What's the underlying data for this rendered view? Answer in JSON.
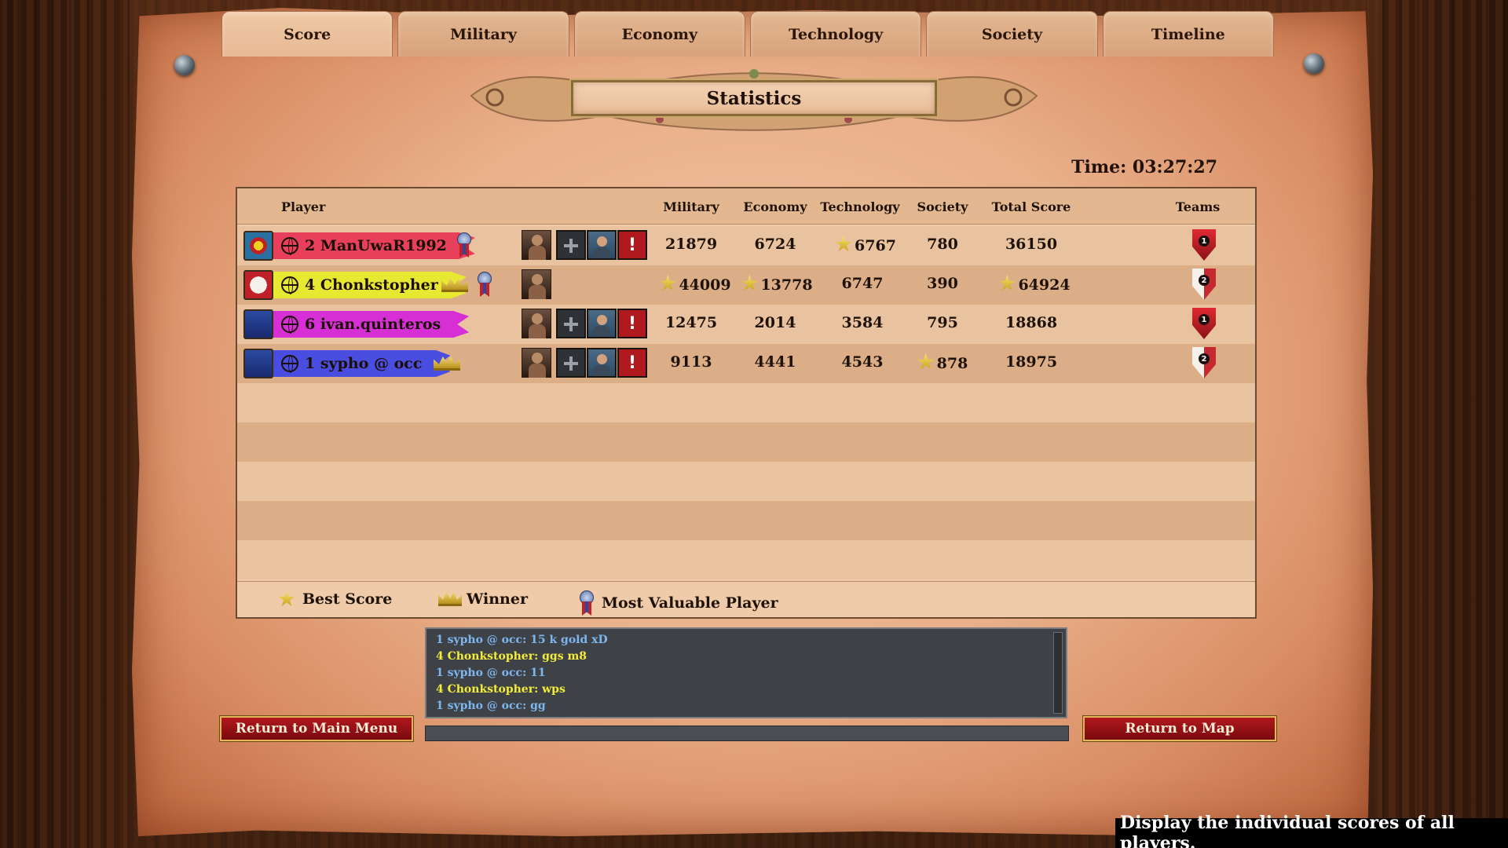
{
  "tabs": [
    "Score",
    "Military",
    "Economy",
    "Technology",
    "Society",
    "Timeline"
  ],
  "title": "Statistics",
  "time": "Time: 03:27:27",
  "columns": {
    "player": "Player",
    "military": "Military",
    "economy": "Economy",
    "technology": "Technology",
    "society": "Society",
    "total": "Total Score",
    "teams": "Teams"
  },
  "players": [
    {
      "name": "2 ManUwaR1992",
      "color": "#e83a4e",
      "military": "21879",
      "economy": "6724",
      "technology": "6767",
      "society": "780",
      "total": "36150",
      "team": "1"
    },
    {
      "name": "4 Chonkstopher",
      "color": "#e6e832",
      "military": "44009",
      "economy": "13778",
      "technology": "6747",
      "society": "390",
      "total": "64924",
      "team": "2"
    },
    {
      "name": "6 ivan.quinteros",
      "color": "#d62fd6",
      "military": "12475",
      "economy": "2014",
      "technology": "3584",
      "society": "795",
      "total": "18868",
      "team": "1"
    },
    {
      "name": "1 sypho  @ occ",
      "color": "#4a4ee0",
      "military": "9113",
      "economy": "4441",
      "technology": "4543",
      "society": "878",
      "total": "18975",
      "team": "2"
    }
  ],
  "legend": {
    "best": "Best Score",
    "winner": "Winner",
    "mvp": "Most Valuable Player"
  },
  "chat": [
    {
      "text": "1 sypho  @ occ: 15 k gold xD",
      "color": "blue"
    },
    {
      "text": "4 Chonkstopher: ggs m8",
      "color": "yellow"
    },
    {
      "text": "1 sypho  @ occ: 11",
      "color": "blue"
    },
    {
      "text": "4 Chonkstopher: wps",
      "color": "yellow"
    },
    {
      "text": "1 sypho  @ occ: gg",
      "color": "blue"
    }
  ],
  "buttons": {
    "main_menu": "Return to Main Menu",
    "map": "Return to Map"
  },
  "tooltip": "Display the individual scores of all players."
}
